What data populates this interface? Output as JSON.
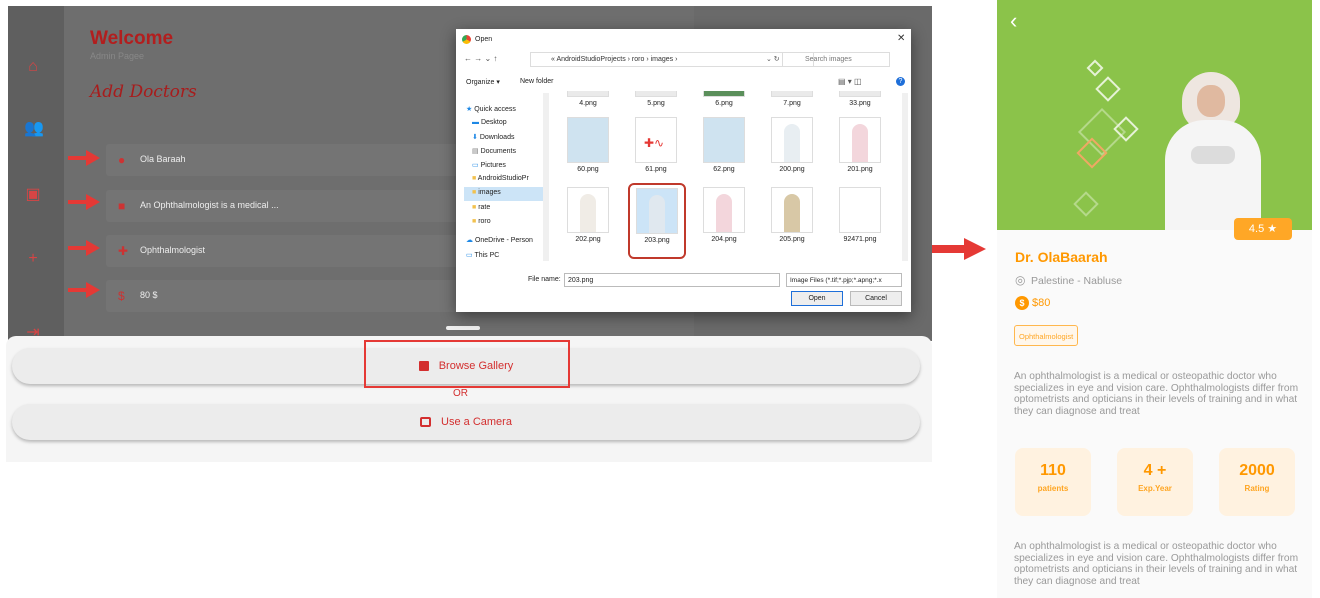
{
  "left_app": {
    "welcome": "Welcome",
    "admin": "Admin Pagee",
    "add_doctors": "Add Doctors",
    "fields": [
      {
        "icon": "person-icon",
        "text": "Ola Baraah"
      },
      {
        "icon": "briefcase-icon",
        "text": "An Ophthalmologist is a medical ..."
      },
      {
        "icon": "medical-cross-icon",
        "text": "Ophthalmologist"
      },
      {
        "icon": "dollar-circle-icon",
        "text": "80 $"
      }
    ]
  },
  "sheet": {
    "browse": "Browse Gallery",
    "or": "OR",
    "camera": "Use a Camera"
  },
  "dialog": {
    "title": "Open",
    "address": "« AndroidStudioProjects › roro › images ›",
    "search_placeholder": "Search images",
    "organize": "Organize ▾",
    "new_folder": "New folder",
    "tree": [
      "Quick access",
      "Desktop",
      "Downloads",
      "Documents",
      "Pictures",
      "AndroidStudioPr",
      "images",
      "rate",
      "roro",
      "OneDrive - Person",
      "This PC"
    ],
    "row1": [
      "4.png",
      "5.png",
      "6.png",
      "7.png",
      "33.png"
    ],
    "row2": [
      "60.png",
      "61.png",
      "62.png",
      "200.png",
      "201.png"
    ],
    "row3": [
      "202.png",
      "203.png",
      "204.png",
      "205.png",
      "92471.png"
    ],
    "file_name_label": "File name:",
    "file_name_value": "203.png",
    "filter": "Image Files (*.tif;*.pjp;*.apng;*.x",
    "open_btn": "Open",
    "cancel_btn": "Cancel"
  },
  "profile": {
    "back": "‹",
    "rating": "4.5 ★",
    "name": "Dr. OlaBaarah",
    "location": "Palestine - Nabluse",
    "price": "$80",
    "specialty": "Ophthalmologist",
    "description": "An ophthalmologist is a medical or osteopathic doctor who specializes in eye and vision care. Ophthalmologists differ from optometrists and opticians in their levels of training and in what they can diagnose and treat",
    "stats": [
      {
        "value": "110",
        "label": "patients"
      },
      {
        "value": "4 +",
        "label": "Exp.Year"
      },
      {
        "value": "2000",
        "label": "Rating"
      }
    ],
    "description2": "An ophthalmologist is a medical or osteopathic doctor who specializes in eye and vision care. Ophthalmologists differ from optometrists and opticians in their levels of training and in what they can diagnose and treat"
  },
  "colors": {
    "primary": "#e53935",
    "green": "#8bc34a",
    "orange": "#ff9800"
  }
}
